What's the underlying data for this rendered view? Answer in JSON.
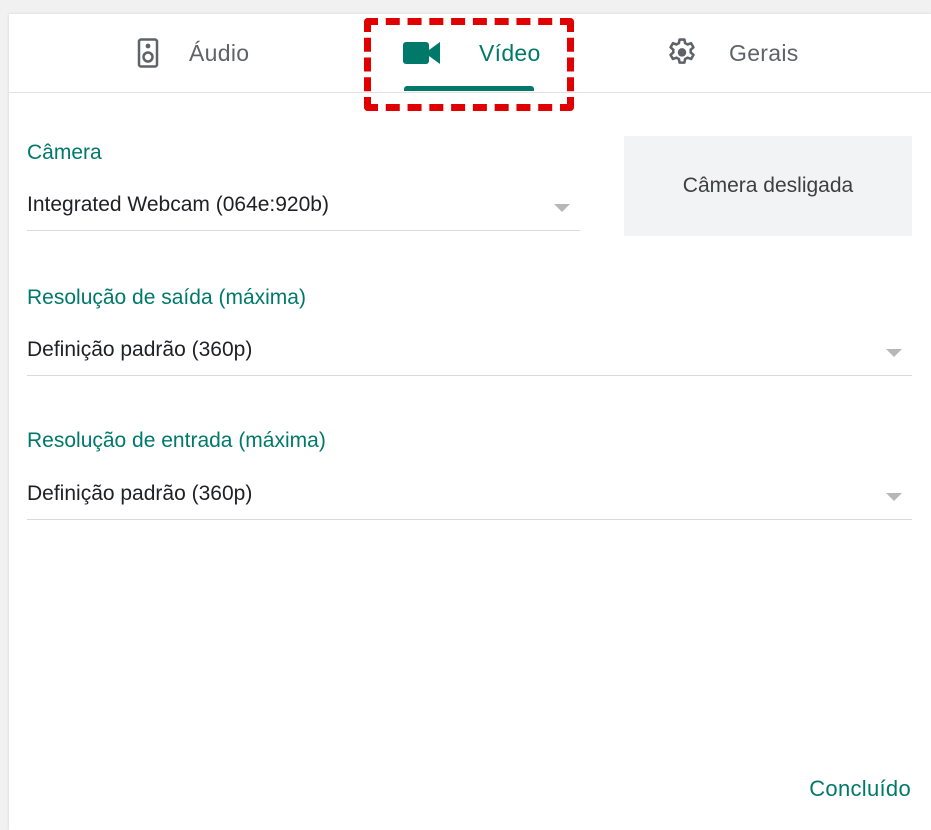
{
  "tabs": {
    "audio": {
      "label": "Áudio",
      "icon": "speaker-icon"
    },
    "video": {
      "label": "Vídeo",
      "icon": "videocam-icon"
    },
    "general": {
      "label": "Gerais",
      "icon": "gear-icon"
    }
  },
  "camera": {
    "label": "Câmera",
    "value": "Integrated Webcam (064e:920b)",
    "preview_text": "Câmera desligada"
  },
  "send_resolution": {
    "label": "Resolução de saída (máxima)",
    "value": "Definição padrão (360p)"
  },
  "receive_resolution": {
    "label": "Resolução de entrada (máxima)",
    "value": "Definição padrão (360p)"
  },
  "footer": {
    "done_label": "Concluído"
  },
  "colors": {
    "accent": "#00796b",
    "highlight": "#e00000",
    "text": "#202124",
    "muted": "#5f6368"
  }
}
